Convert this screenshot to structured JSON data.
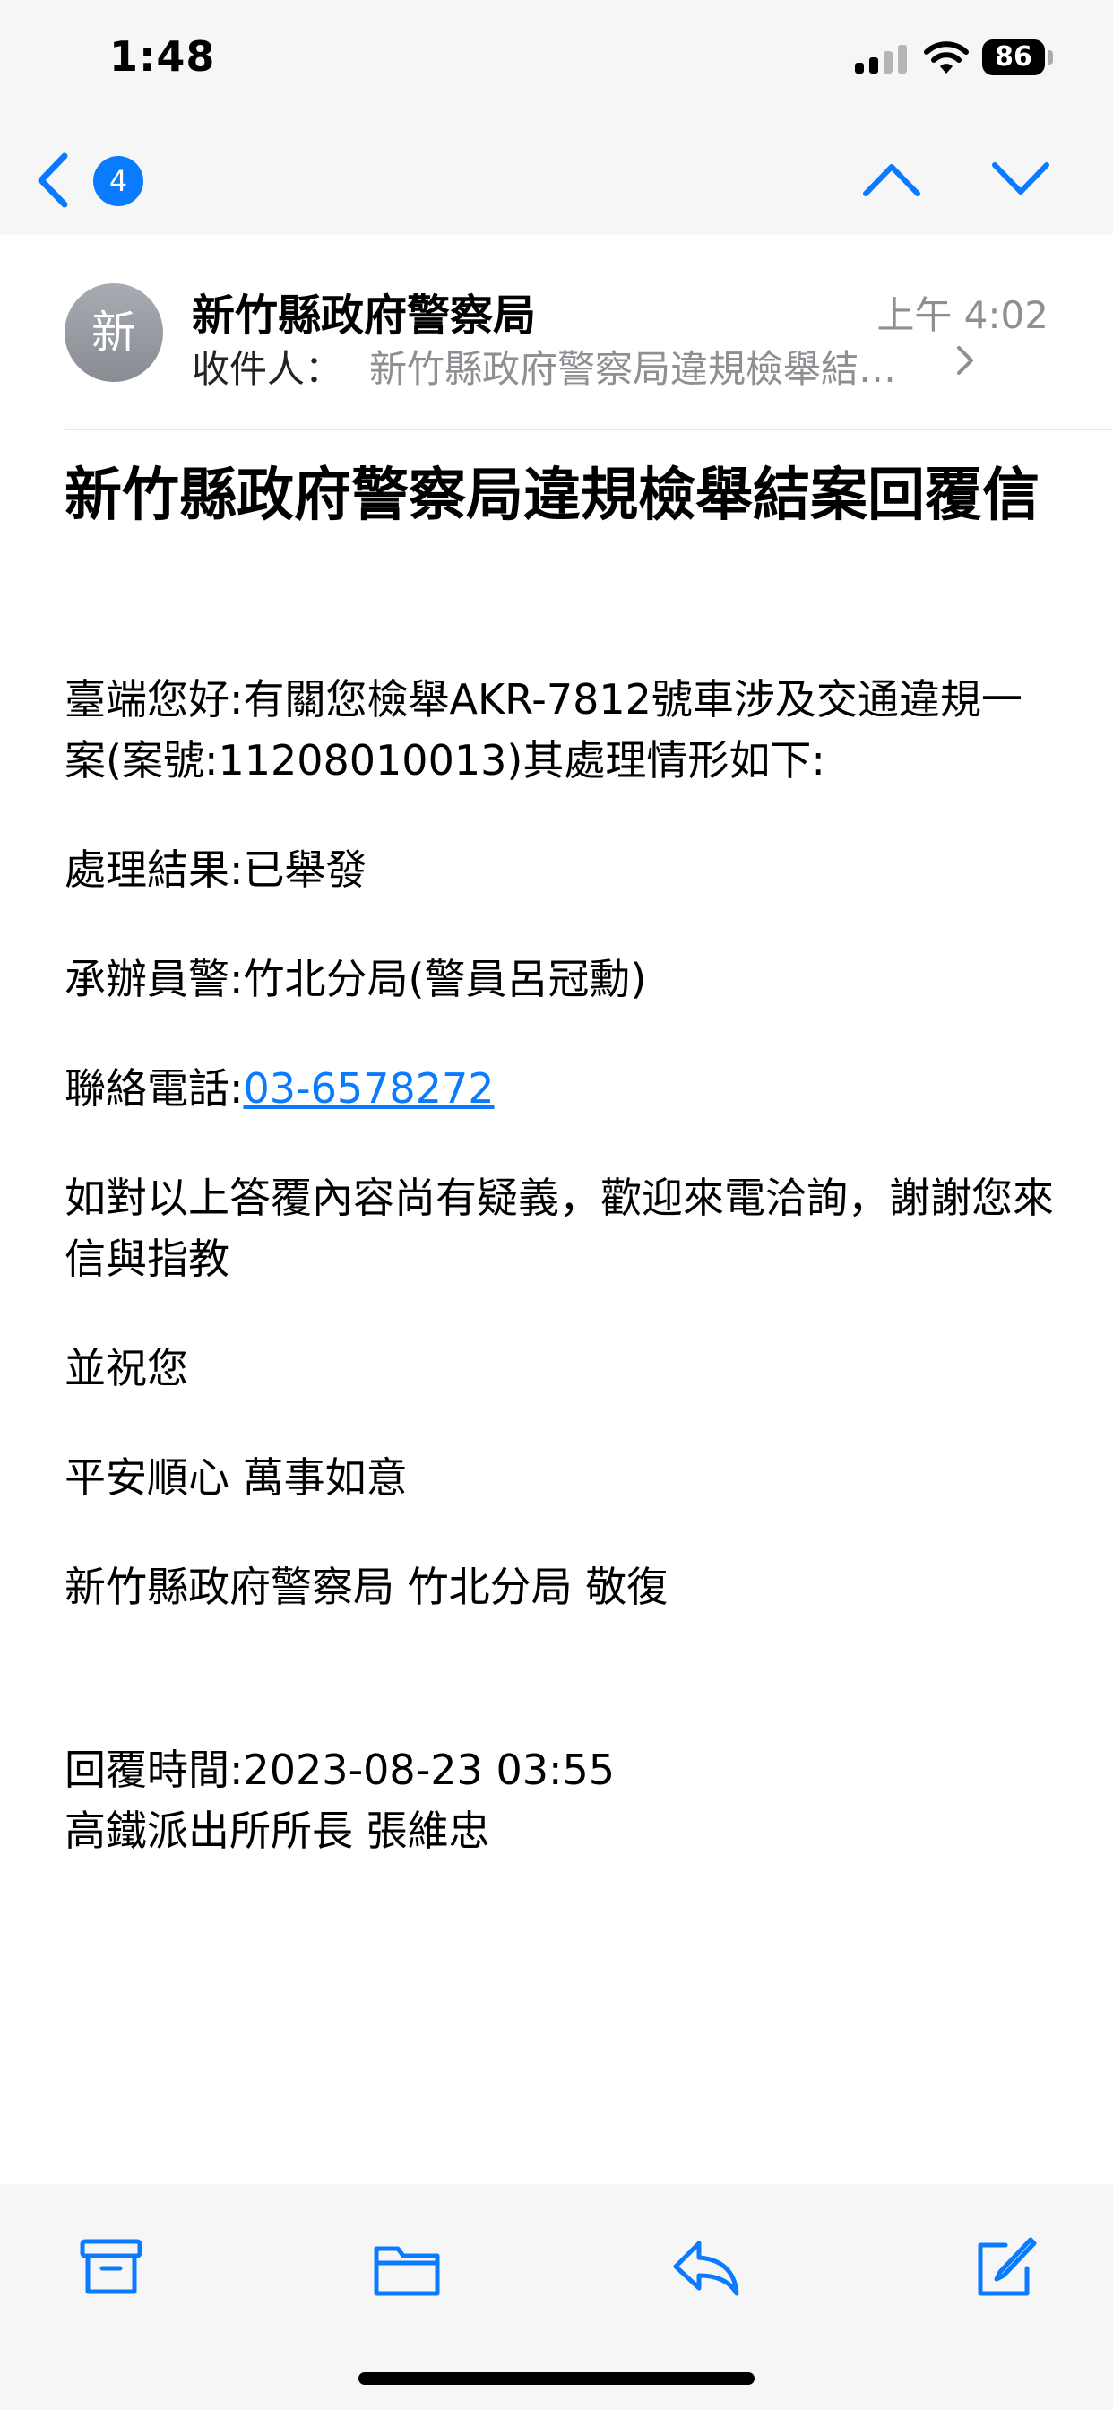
{
  "status_bar": {
    "time": "1:48",
    "battery": "86"
  },
  "nav": {
    "unread_count": "4"
  },
  "header": {
    "avatar_initial": "新",
    "sender": "新竹縣政府警察局",
    "time": "上午 4:02",
    "recipient_label": "收件人：",
    "recipient": "新竹縣政府警察局違規檢舉結…"
  },
  "email": {
    "subject": "新竹縣政府警察局違規檢舉結案回覆信",
    "greeting": "臺端您好:有關您檢舉AKR-7812號車涉及交通違規一案(案號:11208010013)其處理情形如下:",
    "result": "處理結果:已舉發",
    "officer": "承辦員警:竹北分局(警員呂冠勳)",
    "phone_label": "聯絡電話:",
    "phone": "03-6578272",
    "question": "如對以上答覆內容尚有疑義，歡迎來電洽詢，謝謝您來信與指教",
    "wish1": "並祝您",
    "wish2": "平安順心 萬事如意",
    "closing": "新竹縣政府警察局 竹北分局 敬復",
    "reply_time": "回覆時間:2023-08-23 03:55",
    "signer": "高鐵派出所所長 張維忠"
  },
  "toolbar": {
    "icons": [
      "archive-icon",
      "folder-icon",
      "reply-icon",
      "compose-icon"
    ]
  },
  "colors": {
    "accent": "#0a7aff",
    "secondary_text": "#8e8e93"
  }
}
